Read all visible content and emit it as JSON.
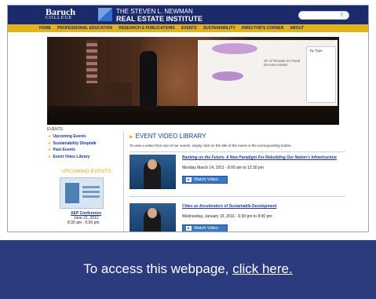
{
  "header": {
    "college_name": "Baruch",
    "college_sub": "COLLEGE",
    "institute_line1": "THE STEVEN L. NEWMAN",
    "institute_line2": "REAL ESTATE INSTITUTE",
    "search": {
      "placeholder": ""
    },
    "colors": {
      "header_bg": "#1b2a6b",
      "nav_bg": "#e2b21d"
    }
  },
  "nav": {
    "items": [
      {
        "label": "HOME"
      },
      {
        "label": "PROFESSIONAL EDUCATION"
      },
      {
        "label": "RESEARCH & PUBLICATIONS"
      },
      {
        "label": "EVENTS"
      },
      {
        "label": "SUSTAINABILITY"
      },
      {
        "label": "DIRECTOR'S CORNER"
      },
      {
        "label": "ABOUT"
      }
    ]
  },
  "hero": {
    "slide_caption": "SF of Tenants on Fixed Escrow Leases",
    "slide_legend_title": "by Type"
  },
  "sidebar": {
    "heading": "EVENTS",
    "links": [
      {
        "label": "Upcoming Events"
      },
      {
        "label": "Sustainability Shoptalk"
      },
      {
        "label": "Past Events"
      },
      {
        "label": "Event Video Library"
      }
    ],
    "upcoming": {
      "heading": "UPCOMING EVENTS",
      "title": "AEP Conference",
      "date": "June 21, 2012",
      "time": "8:30 am - 5:00 pm"
    }
  },
  "main": {
    "title": "EVENT VIDEO LIBRARY",
    "description": "To view a video from one of our events, simply click on the title of the event or the corresponding button.",
    "videos": [
      {
        "title": "Banking on the Future: A New Paradigm For Rebuilding Our Nation's Infrastructure",
        "date": "Monday March 14, 2011 - 8:00 am to 12:30 pm",
        "button": "Watch Video"
      },
      {
        "title": "Cities as Accelerators of Sustainable Development",
        "date": "Wednesday, January 19, 2011 - 6:00 pm to 8:00 pm",
        "button": "Watch Video"
      }
    ]
  },
  "banner": {
    "text": "To access this webpage, ",
    "link": "click here.",
    "bg_color": "#2c3a7e"
  }
}
